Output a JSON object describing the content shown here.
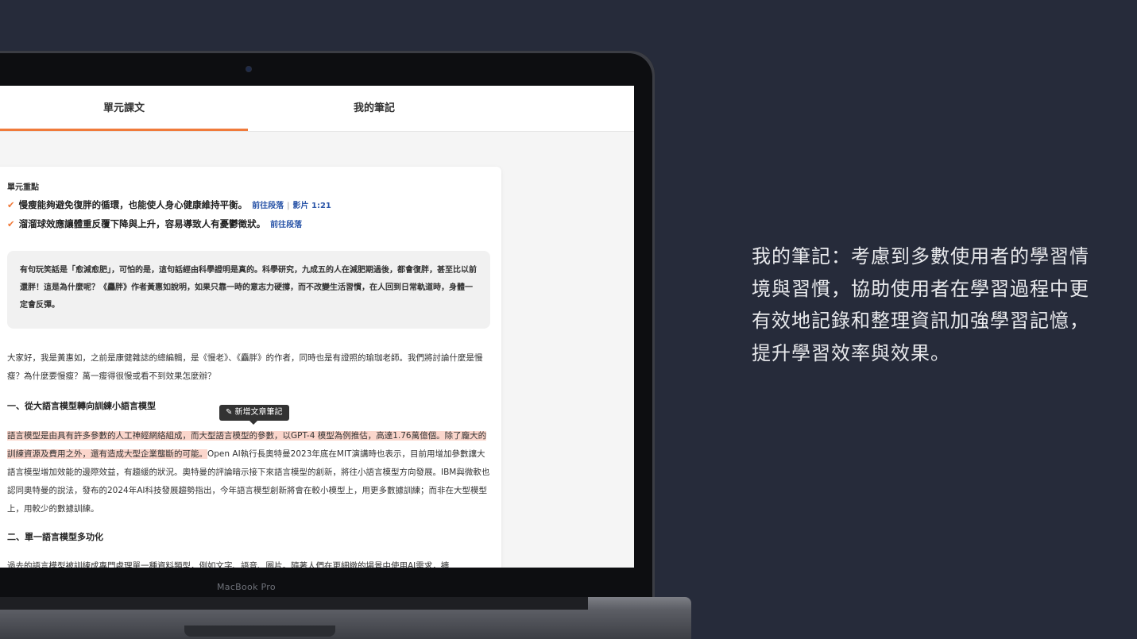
{
  "caption": "我的筆記：考慮到多數使用者的學習情境與習慣，協助使用者在學習過程中更有效地記錄和整理資訊加強學習記憶，提升學習效率與效果。",
  "laptop": {
    "brand": "MacBook Pro"
  },
  "tabs": [
    {
      "label": "單元課文",
      "active": true
    },
    {
      "label": "我的筆記",
      "active": false
    }
  ],
  "key_points": {
    "title": "單元重點",
    "items": [
      {
        "text": "慢瘦能夠避免復胖的循環，也能使人身心健康維持平衡。",
        "link1": "前往段落",
        "link2": "影片 1:21"
      },
      {
        "text": "溜溜球效應讓體重反覆下降與上升，容易導致人有憂鬱徵狀。",
        "link1": "前往段落"
      }
    ]
  },
  "quote": "有句玩笑話是「愈減愈肥」，可怕的是，這句話經由科學證明是真的。科學研究，九成五的人在減肥期過後，都會復胖，甚至比以前還胖！這是為什麼呢？《麤胖》作者黃惠如說明，如果只靠一時的意志力硬撐，而不改變生活習慣，在人回到日常軌道時，身體一定會反彈。",
  "intro": "大家好，我是黃惠如，之前是康健雜誌的總編輯，是《慢老》、《麤胖》的作者，同時也是有證照的瑜珈老師。我們將討論什麼是慢瘦？為什麼要慢瘦？萬一瘦得很慢或看不到效果怎麼辦？",
  "section1": {
    "heading": "一、從大語言模型轉向訓練小語言模型",
    "tooltip": "✎ 新增文章筆記",
    "highlight": "語言模型是由具有許多參數的人工神經網絡組成，而大型語言模型的參數，以GPT-4 模型為例推估，高達1.76萬億個。除了龐大的訓練資源及費用之外，還有造成大型企業壟斷的可能。",
    "rest": "Open AI執行長奧特曼2023年底在MIT演講時也表示，目前用增加參數讓大語言模型增加效能的邊際效益，有趨緩的狀況。奧特曼的評論暗示接下來語言模型的創新，將往小語言模型方向發展。IBM與微軟也認同奧特曼的說法，發布的2024年AI科技發展趨勢指出，今年語言模型創新將會在較小模型上，用更多數據訓練；而非在大型模型上，用較少的數據訓練。"
  },
  "section2": {
    "heading": "二、單一語言模型多功化",
    "text": "過去的語言模型被訓練成專門處理單一種資料類型，例如文字、語音、圖片。隨著人們在更細緻的場景中使用AI需求，擴"
  },
  "colors": {
    "accent": "#f07a3a",
    "link": "#2a55a8",
    "highlight": "#fbd6cc",
    "background": "#262b3a"
  }
}
